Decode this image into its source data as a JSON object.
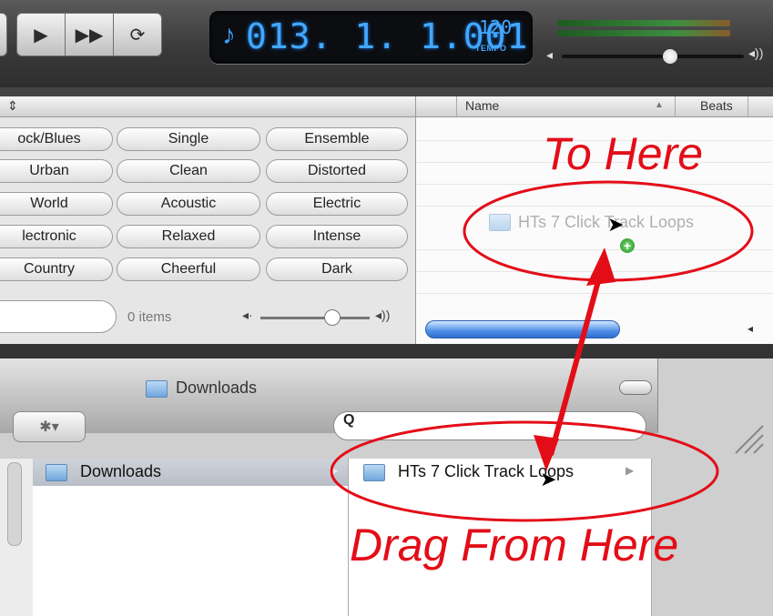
{
  "transport": {
    "lcd_position": "013. 1. 1.001",
    "tempo_value": "120",
    "tempo_label": "TEMPO"
  },
  "loop_browser": {
    "keywords": [
      [
        "ock/Blues",
        "Single",
        "Ensemble"
      ],
      [
        "Urban",
        "Clean",
        "Distorted"
      ],
      [
        "World",
        "Acoustic",
        "Electric"
      ],
      [
        "lectronic",
        "Relaxed",
        "Intense"
      ],
      [
        "Country",
        "Cheerful",
        "Dark"
      ]
    ],
    "items_count": "0 items",
    "columns": {
      "name": "Name",
      "beats": "Beats"
    },
    "dragging_item": "HTs 7 Click Track Loops"
  },
  "finder": {
    "title": "Downloads",
    "search_glyph": "Q",
    "sidebar_selected": "Downloads",
    "column_item": "HTs 7 Click Track Loops"
  },
  "annotations": {
    "to_here": "To Here",
    "drag_from_here": "Drag From Here"
  },
  "colors": {
    "annotation": "#e30d18",
    "lcd": "#42a8ff",
    "scroll": "#4f8fe6"
  }
}
